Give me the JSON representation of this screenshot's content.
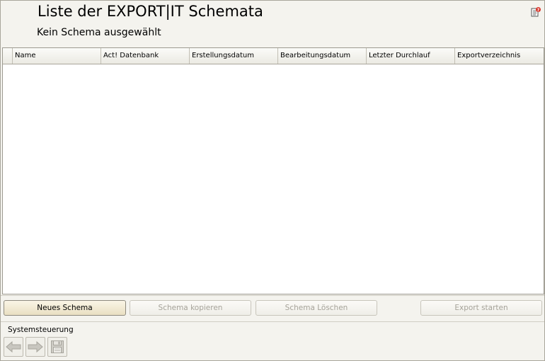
{
  "header": {
    "title": "Liste der EXPORT|IT Schemata",
    "subtitle": "Kein Schema ausgewählt",
    "help_icon": "help-document-icon"
  },
  "grid": {
    "columns": [
      "Name",
      "Act! Datenbank",
      "Erstellungsdatum",
      "Bearbeitungsdatum",
      "Letzter Durchlauf",
      "Exportverzeichnis"
    ],
    "rows": []
  },
  "buttons": {
    "new_schema": "Neues Schema",
    "copy_schema": "Schema kopieren",
    "delete_schema": "Schema Löschen",
    "start_export": "Export starten"
  },
  "system": {
    "label": "Systemsteuerung",
    "back_icon": "arrow-left-icon",
    "forward_icon": "arrow-right-icon",
    "save_icon": "save-disk-icon"
  }
}
